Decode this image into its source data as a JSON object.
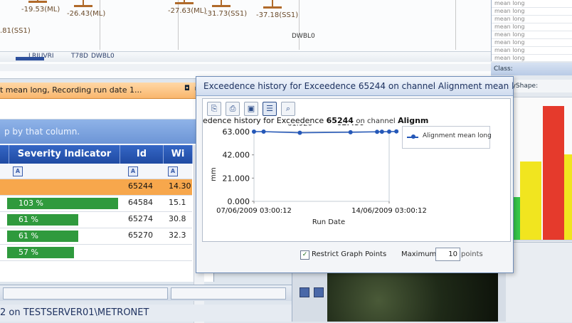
{
  "track": {
    "markers": [
      {
        "label": "-19.53(ML)"
      },
      {
        "label": "-26.43(ML)"
      },
      {
        "label": "-27.63(ML)"
      },
      {
        "label": "-31.73(SS1)"
      },
      {
        "label": "-37.18(SS1)"
      },
      {
        "label": ".81(SS1)"
      }
    ],
    "dwbl_label": "DWBL0",
    "strip_labels": [
      "LRIUVRI",
      "T78D",
      "DWBL0"
    ]
  },
  "left_panel": {
    "title": "t mean long, Recording run date 1...",
    "group_hint": "p by that column.",
    "columns": {
      "severity": "Severity Indicator",
      "id": "Id",
      "wi": "Wi"
    },
    "filter_glyph": "A",
    "rows": [
      {
        "severity": "",
        "id": "65244",
        "wi": "14.30",
        "selected": true
      },
      {
        "severity": "103 %",
        "id": "64584",
        "wi": "15.1"
      },
      {
        "severity": "61 %",
        "id": "65274",
        "wi": "30.8"
      },
      {
        "severity": "61 %",
        "id": "65270",
        "wi": "32.3"
      },
      {
        "severity": "57 %",
        "id": "",
        "wi": ""
      }
    ]
  },
  "server": {
    "text": "2 on TESTSERVER01\\METRONET"
  },
  "right_panel": {
    "list_items": [
      "mean long",
      "mean long",
      "mean long",
      "mean long",
      "mean long",
      "mean long",
      "mean long",
      "mean long"
    ],
    "tab_label": "Class:",
    "tab2_label": "AggyShape:",
    "colors": {
      "red": "#e53a2c",
      "yellow": "#f1e51f",
      "green": "#37c94a"
    }
  },
  "exceedence": {
    "window_title": "Exceedence history for Exceedence 65244 on channel Alignment mean long",
    "chart_title_prefix": "edence history for Exceedence",
    "chart_title_id": "65244",
    "chart_title_mid": "on channel",
    "chart_title_channel": "Alignm",
    "legend_label": "Alignment mean long",
    "restrict_label": "Restrict Graph Points",
    "restrict_checked": true,
    "maximum_label": "Maximum",
    "maximum_value": "10",
    "points_label": "points",
    "toolbar_icons": [
      "copy-icon",
      "print-icon",
      "save-icon",
      "list-icon",
      "zoom-icon"
    ]
  },
  "chart_data": {
    "type": "line",
    "ylabel": "mm",
    "xlabel": "Run Date",
    "ylim": [
      0,
      63
    ],
    "yticks": [
      "0.000",
      "21.000",
      "42.000",
      "63.000"
    ],
    "xticks": [
      "07/06/2009 03:00:12",
      "14/06/2009 03:00:12"
    ],
    "series": [
      {
        "name": "Alignment mean long",
        "color": "#2558b8",
        "x": [
          "07/06/2009 03:00:12",
          "07/06/2009 15:00:00",
          "09/06/2009 12:00:00",
          "12/06/2009 03:00:12",
          "13/06/2009 12:00:00",
          "13/06/2009 18:00:00",
          "14/06/2009 03:00:12",
          "14/06/2009 12:00:00"
        ],
        "y": [
          63.0,
          63.0,
          61.92,
          62.43,
          62.8,
          62.9,
          63.0,
          63.2
        ]
      }
    ],
    "data_labels": [
      "63.000",
      "61.920",
      "62.430",
      "62.800",
      "63.190"
    ]
  }
}
